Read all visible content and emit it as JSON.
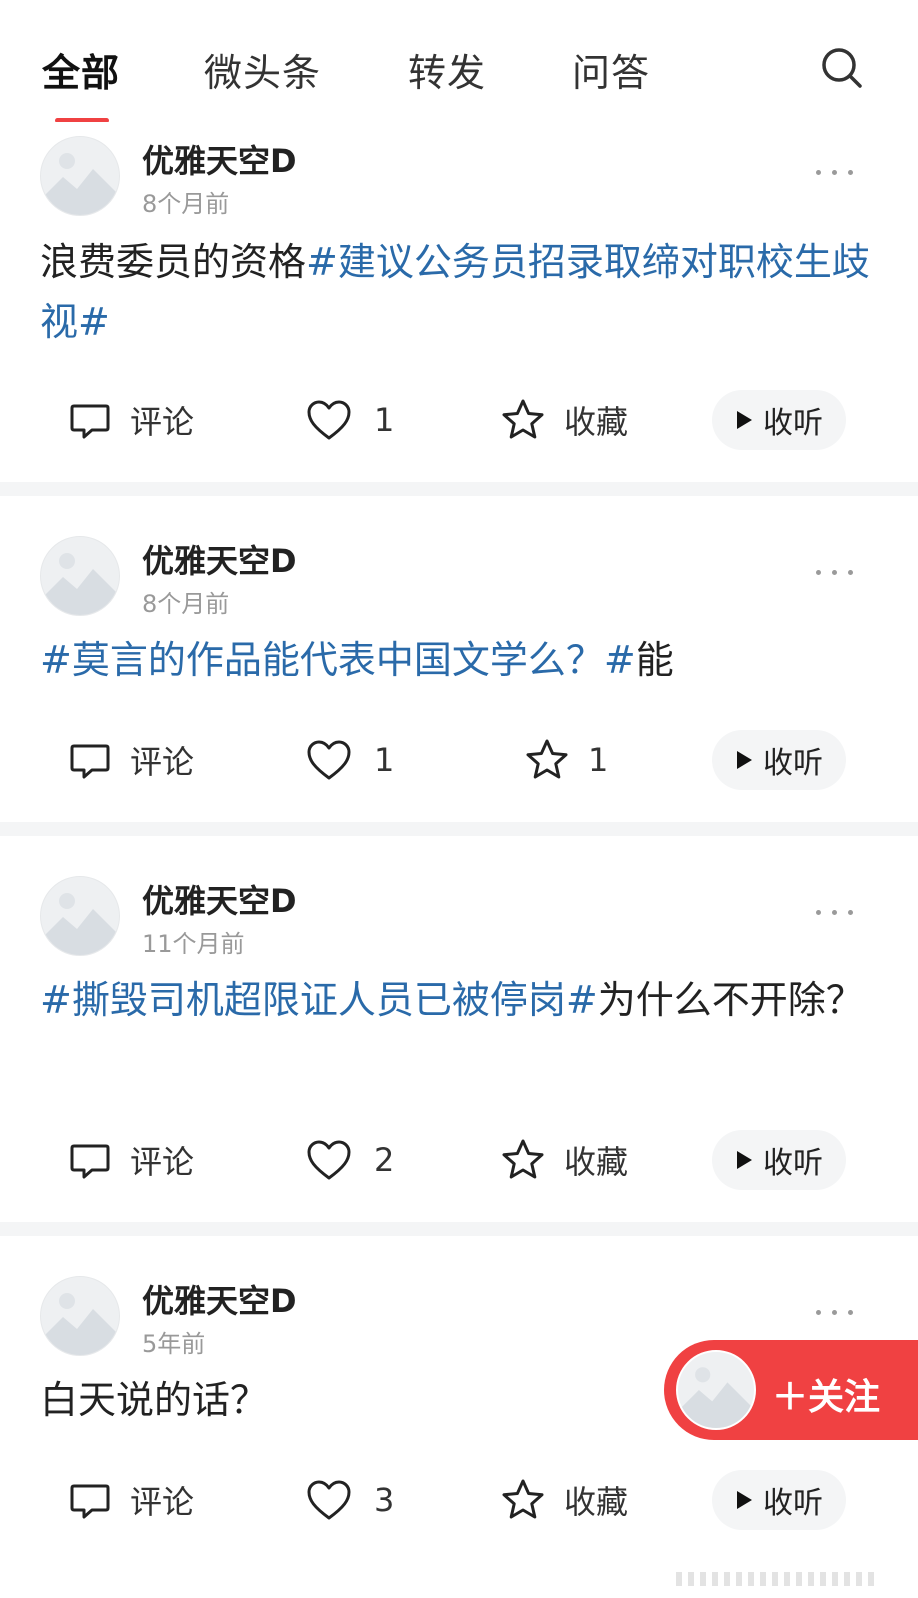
{
  "tabs": [
    {
      "label": "全部",
      "active": true
    },
    {
      "label": "微头条"
    },
    {
      "label": "转发"
    },
    {
      "label": "问答"
    }
  ],
  "search_icon": "search-icon",
  "posts": [
    {
      "username": "优雅天空D",
      "time": "8个月前",
      "content": [
        {
          "text": "浪费委员的资格",
          "tag": false
        },
        {
          "text": "#建议公务员招录取缔对职校生歧视#",
          "tag": true
        }
      ],
      "comment_label": "评论",
      "like_count": "1",
      "fav_label": "收藏",
      "listen_label": "收听"
    },
    {
      "username": "优雅天空D",
      "time": "8个月前",
      "content": [
        {
          "text": "#莫言的作品能代表中国文学么？#",
          "tag": true
        },
        {
          "text": "能",
          "tag": false
        }
      ],
      "comment_label": "评论",
      "like_count": "1",
      "fav_label": "1",
      "listen_label": "收听"
    },
    {
      "username": "优雅天空D",
      "time": "11个月前",
      "content": [
        {
          "text": "#撕毁司机超限证人员已被停岗#",
          "tag": true
        },
        {
          "text": "为什么不开除？",
          "tag": false
        }
      ],
      "comment_label": "评论",
      "like_count": "2",
      "fav_label": "收藏",
      "listen_label": "收听"
    },
    {
      "username": "优雅天空D",
      "time": "5年前",
      "content": [
        {
          "text": "白天说的话？",
          "tag": false
        }
      ],
      "comment_label": "评论",
      "like_count": "3",
      "fav_label": "收藏",
      "listen_label": "收听"
    }
  ],
  "follow_label": "＋关注",
  "colors": {
    "accent": "#f04142",
    "tag": "#2a6aa9",
    "divider": "#f4f5f6"
  }
}
